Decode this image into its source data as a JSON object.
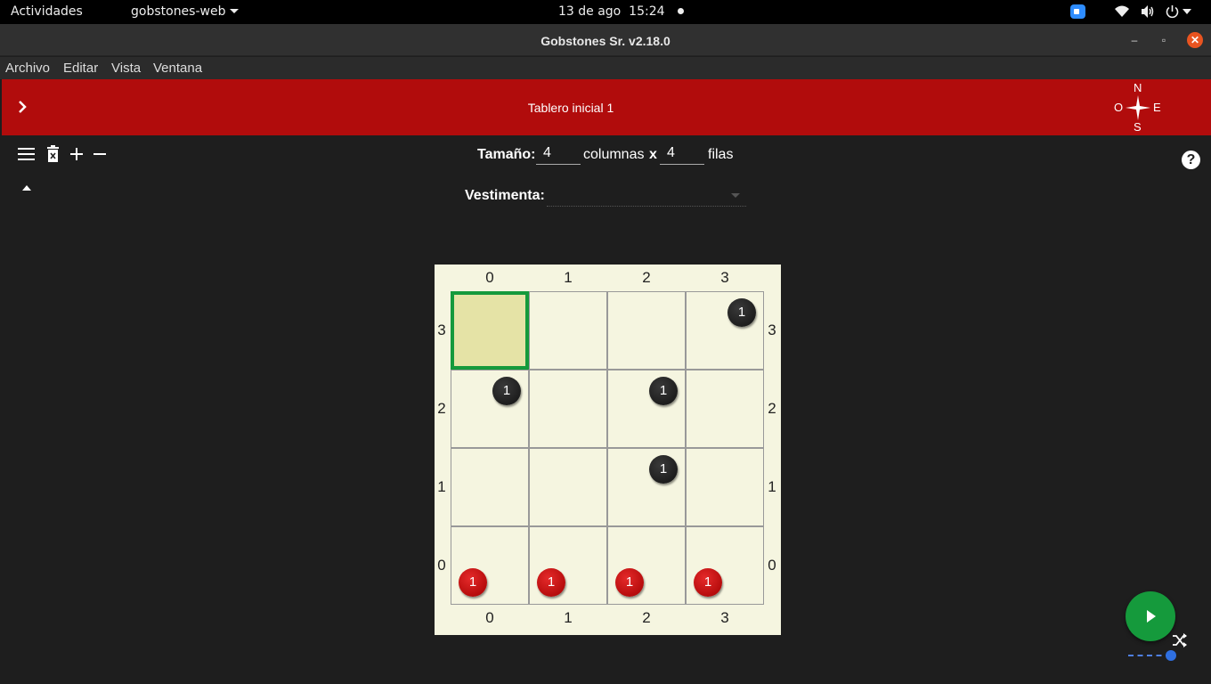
{
  "topbar": {
    "activities": "Actividades",
    "app_menu": "gobstones-web",
    "date": "13 de ago",
    "time": "15:24"
  },
  "window": {
    "title": "Gobstones Sr. v2.18.0"
  },
  "menubar": [
    "Archivo",
    "Editar",
    "Vista",
    "Ventana"
  ],
  "header": {
    "title": "Tablero inicial 1",
    "compass": {
      "n": "N",
      "s": "S",
      "e": "E",
      "o": "O"
    }
  },
  "size": {
    "label": "Tamaño:",
    "columns_value": "4",
    "columns_label": "columnas",
    "x": "x",
    "rows_value": "4",
    "rows_label": "filas"
  },
  "vestimenta": {
    "label": "Vestimenta:",
    "value": ""
  },
  "help_glyph": "?",
  "board": {
    "columns": [
      "0",
      "1",
      "2",
      "3"
    ],
    "rows": [
      "3",
      "2",
      "1",
      "0"
    ],
    "head": {
      "x": 0,
      "y": 3
    },
    "colors": {
      "negro": "#111111",
      "rojo": "#c40000",
      "head_border": "#159a3c",
      "head_fill": "#e5e3a6",
      "board_bg": "#f5f5e0"
    },
    "stones": [
      {
        "x": 3,
        "y": 3,
        "color": "negro",
        "count": "1"
      },
      {
        "x": 0,
        "y": 2,
        "color": "negro",
        "count": "1"
      },
      {
        "x": 2,
        "y": 2,
        "color": "negro",
        "count": "1"
      },
      {
        "x": 2,
        "y": 1,
        "color": "negro",
        "count": "1"
      },
      {
        "x": 0,
        "y": 0,
        "color": "rojo",
        "count": "1"
      },
      {
        "x": 1,
        "y": 0,
        "color": "rojo",
        "count": "1"
      },
      {
        "x": 2,
        "y": 0,
        "color": "rojo",
        "count": "1"
      },
      {
        "x": 3,
        "y": 0,
        "color": "rojo",
        "count": "1"
      }
    ]
  },
  "icons": {
    "menu": "hamburger-icon",
    "delete": "delete-board-icon",
    "add": "plus-icon",
    "remove": "minus-icon",
    "collapse": "caret-up-icon",
    "run": "play-icon",
    "shuffle": "shuffle-icon"
  }
}
